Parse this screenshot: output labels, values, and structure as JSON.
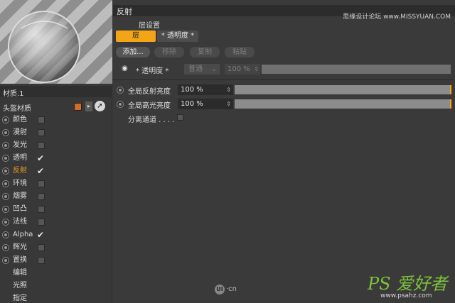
{
  "material": {
    "name": "材质.1",
    "type_label": "头盔材质",
    "swatch_color": "#d26a2c"
  },
  "channels": [
    {
      "label": "颜色",
      "checked": false,
      "active": false
    },
    {
      "label": "漫射",
      "checked": false,
      "active": false
    },
    {
      "label": "发光",
      "checked": false,
      "active": false
    },
    {
      "label": "透明",
      "checked": true,
      "active": false
    },
    {
      "label": "反射",
      "checked": true,
      "active": true
    },
    {
      "label": "环境",
      "checked": false,
      "active": false
    },
    {
      "label": "烟雾",
      "checked": false,
      "active": false
    },
    {
      "label": "凹凸",
      "checked": false,
      "active": false
    },
    {
      "label": "法线",
      "checked": false,
      "active": false
    },
    {
      "label": "Alpha",
      "checked": true,
      "active": false
    },
    {
      "label": "辉光",
      "checked": false,
      "active": false
    },
    {
      "label": "置换",
      "checked": false,
      "active": false
    }
  ],
  "extra_items": [
    "编辑",
    "光照",
    "指定"
  ],
  "panel": {
    "title": "反射",
    "watermark": "思缘设计论坛 www.MISSYUAN.COM",
    "layer_settings": "层设置",
    "tab_layer": "层",
    "tab_transparency": "* 透明度 *",
    "buttons": {
      "add": "添加...",
      "remove": "移除",
      "copy": "复制",
      "paste": "粘贴"
    },
    "transparency": {
      "eye_icon": "eye-icon",
      "label": "* 透明度 *",
      "mode": "普通",
      "value": "100 %"
    },
    "global_reflection": {
      "label": "全局反射亮度",
      "value": "100 %",
      "level": 1.0
    },
    "global_specular": {
      "label": "全局高光亮度",
      "value": "100 %",
      "level": 1.0
    },
    "separate_pass": {
      "label": "分离通道 . . . .",
      "checked": false
    }
  },
  "logos": {
    "ui_logo": "UI·cn",
    "site_logo": "PS 爱好者",
    "site_url": "www.psahz.com"
  },
  "colors": {
    "accent": "#f2a516",
    "active_text": "#f0a020"
  }
}
